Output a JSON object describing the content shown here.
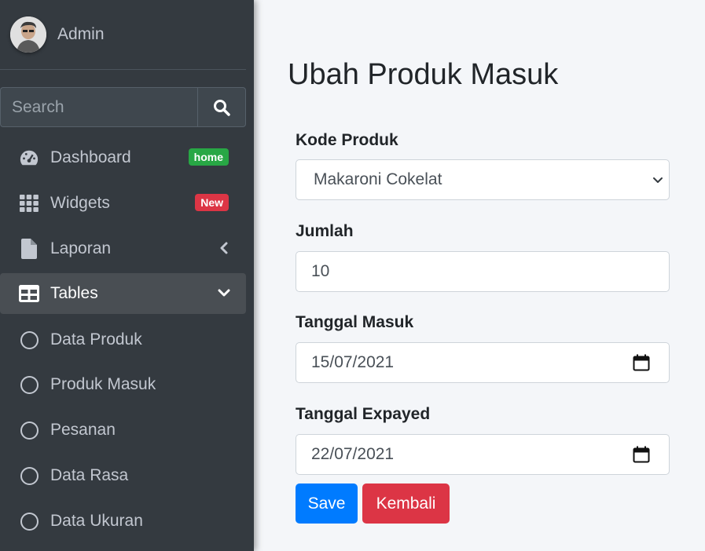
{
  "user": {
    "name": "Admin"
  },
  "search": {
    "placeholder": "Search",
    "icon": "search-icon"
  },
  "nav": {
    "dashboard": {
      "label": "Dashboard",
      "badge": "home",
      "icon": "tachometer-icon"
    },
    "widgets": {
      "label": "Widgets",
      "badge": "New",
      "icon": "grid-icon"
    },
    "laporan": {
      "label": "Laporan",
      "icon": "file-icon"
    },
    "tables": {
      "label": "Tables",
      "icon": "table-icon"
    },
    "sub": [
      {
        "label": "Data Produk"
      },
      {
        "label": "Produk Masuk"
      },
      {
        "label": "Pesanan"
      },
      {
        "label": "Data Rasa"
      },
      {
        "label": "Data Ukuran"
      }
    ]
  },
  "form": {
    "title": "Ubah Produk Masuk",
    "kode_label": "Kode Produk",
    "kode_value": "Makaroni Cokelat",
    "jumlah_label": "Jumlah",
    "jumlah_value": "10",
    "tgl_masuk_label": "Tanggal Masuk",
    "tgl_masuk_value": "15/07/2021",
    "tgl_exp_label": "Tanggal Expayed",
    "tgl_exp_value": "22/07/2021",
    "save_label": "Save",
    "back_label": "Kembali"
  },
  "colors": {
    "sidebar": "#343a40",
    "primary": "#007bff",
    "danger": "#dc3545",
    "success": "#28a745"
  }
}
